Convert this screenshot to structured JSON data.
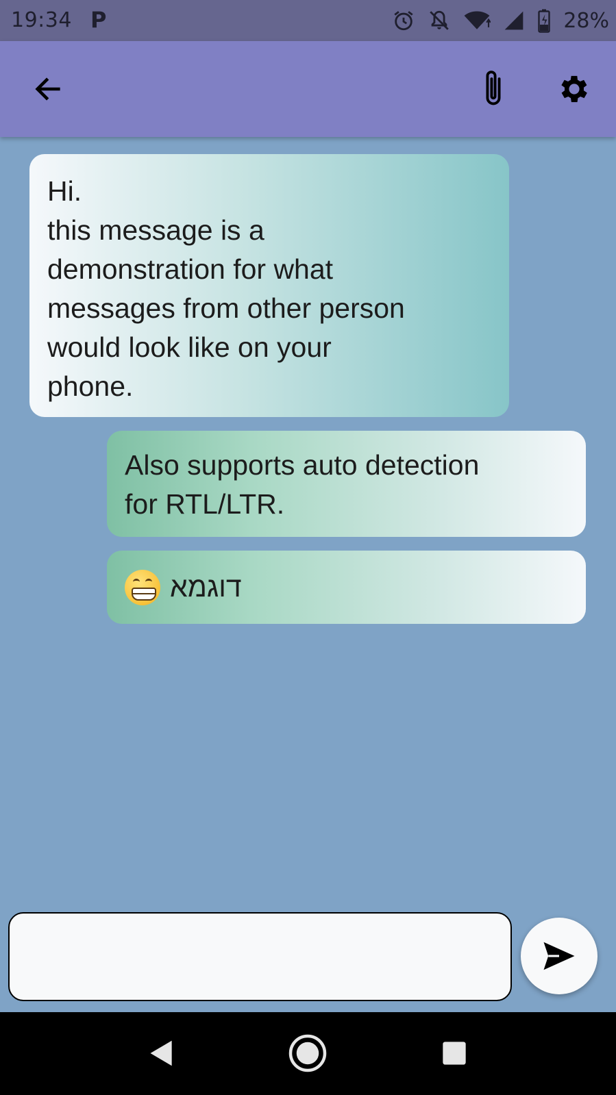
{
  "status_bar": {
    "time": "19:34",
    "notification_app": "P",
    "battery_percent": "28%",
    "icons": [
      "alarm-icon",
      "notifications-off-icon",
      "wifi-icon",
      "cell-signal-icon",
      "battery-charging-icon"
    ]
  },
  "app_bar": {
    "icons": [
      "back-arrow-icon",
      "paperclip-icon",
      "gear-icon"
    ],
    "color": "#8080c4"
  },
  "messages": [
    {
      "direction": "incoming",
      "text": "Hi.\nthis message is a\ndemonstration for what\nmessages from other person\nwould look like on your\nphone."
    },
    {
      "direction": "outgoing",
      "text": "Also supports auto detection\nfor RTL/LTR."
    },
    {
      "direction": "outgoing",
      "text": "דוגמא",
      "emoji": "grinning-face-icon"
    }
  ],
  "composer": {
    "value": "",
    "placeholder": "",
    "send_icon": "send-icon"
  },
  "nav_bar": {
    "icons": [
      "nav-back-icon",
      "nav-home-icon",
      "nav-recents-icon"
    ]
  },
  "colors": {
    "chat_background": "#7fa3c6",
    "status_bar": "#66668f",
    "incoming_gradient": [
      "#f5f8fb",
      "#87c5c8"
    ],
    "outgoing_gradient": [
      "#7fc0a4",
      "#f5f8fb"
    ]
  }
}
